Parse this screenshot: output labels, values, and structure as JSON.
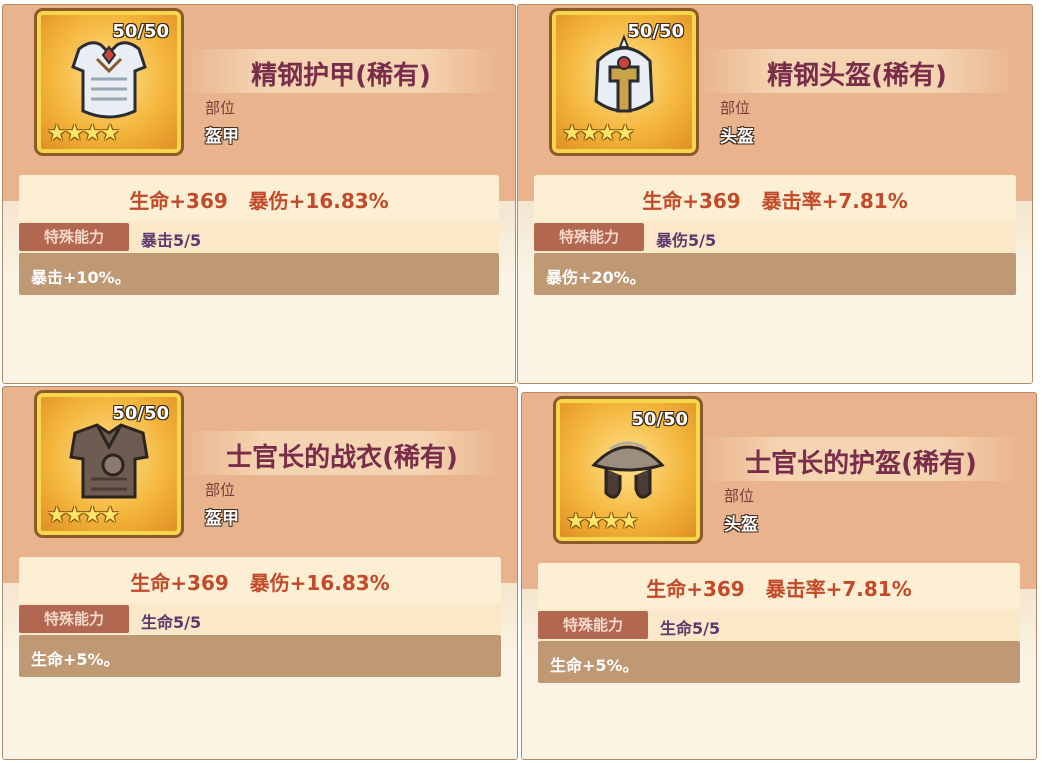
{
  "cards": [
    {
      "level": "50/50",
      "stars": [
        "★",
        "★",
        "★",
        "★"
      ],
      "title": "精钢护甲(稀有)",
      "slot_label": "部位",
      "slot_value": "盔甲",
      "stats": "生命+369   暴伤+16.83%",
      "special_tag": "特殊能力",
      "special_name": "暴击5/5",
      "description": "暴击+10%。",
      "icon": "steel-armor-icon"
    },
    {
      "level": "50/50",
      "stars": [
        "★",
        "★",
        "★",
        "★"
      ],
      "title": "精钢头盔(稀有)",
      "slot_label": "部位",
      "slot_value": "头盔",
      "stats": "生命+369   暴击率+7.81%",
      "special_tag": "特殊能力",
      "special_name": "暴伤5/5",
      "description": "暴伤+20%。",
      "icon": "steel-helmet-icon"
    },
    {
      "level": "50/50",
      "stars": [
        "★",
        "★",
        "★",
        "★"
      ],
      "title": "士官长的战衣(稀有)",
      "slot_label": "部位",
      "slot_value": "盔甲",
      "stats": "生命+369   暴伤+16.83%",
      "special_tag": "特殊能力",
      "special_name": "生命5/5",
      "description": "生命+5%。",
      "icon": "sergeant-armor-icon"
    },
    {
      "level": "50/50",
      "stars": [
        "★",
        "★",
        "★",
        "★"
      ],
      "title": "士官长的护盔(稀有)",
      "slot_label": "部位",
      "slot_value": "头盔",
      "stats": "生命+369   暴击率+7.81%",
      "special_tag": "特殊能力",
      "special_name": "生命5/5",
      "description": "生命+5%。",
      "icon": "sergeant-helmet-icon"
    }
  ]
}
